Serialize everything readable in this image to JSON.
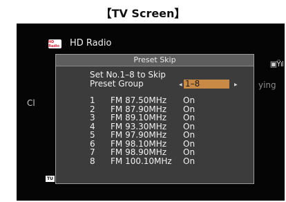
{
  "caption": "【TV Screen】",
  "header": {
    "logo_text": "HD Radio",
    "title": "HD Radio"
  },
  "background": {
    "signal_text": "▣Ÿıl",
    "partial_right": "ying",
    "partial_left": "Cl",
    "tuner_badge": "TU"
  },
  "dialog": {
    "title": "Preset Skip",
    "set_line": "Set No.1–8 to Skip",
    "group_label": "Preset Group",
    "group_value": "1–8",
    "arrow_left": "◀",
    "arrow_right": "▶",
    "presets": [
      {
        "num": "1",
        "freq": "FM 87.50MHz",
        "state": "On"
      },
      {
        "num": "2",
        "freq": "FM 87.90MHz",
        "state": "On"
      },
      {
        "num": "3",
        "freq": "FM 89.10MHz",
        "state": "On"
      },
      {
        "num": "4",
        "freq": "FM 93.30MHz",
        "state": "On"
      },
      {
        "num": "5",
        "freq": "FM 97.90MHz",
        "state": "On"
      },
      {
        "num": "6",
        "freq": "FM 98.10MHz",
        "state": "On"
      },
      {
        "num": "7",
        "freq": "FM 98.90MHz",
        "state": "On"
      },
      {
        "num": "8",
        "freq": "FM 100.10MHz",
        "state": "On"
      }
    ]
  },
  "colors": {
    "screen_bg": "#050505",
    "dialog_bg": "#3c3c3c",
    "highlight": "#c98a45"
  }
}
